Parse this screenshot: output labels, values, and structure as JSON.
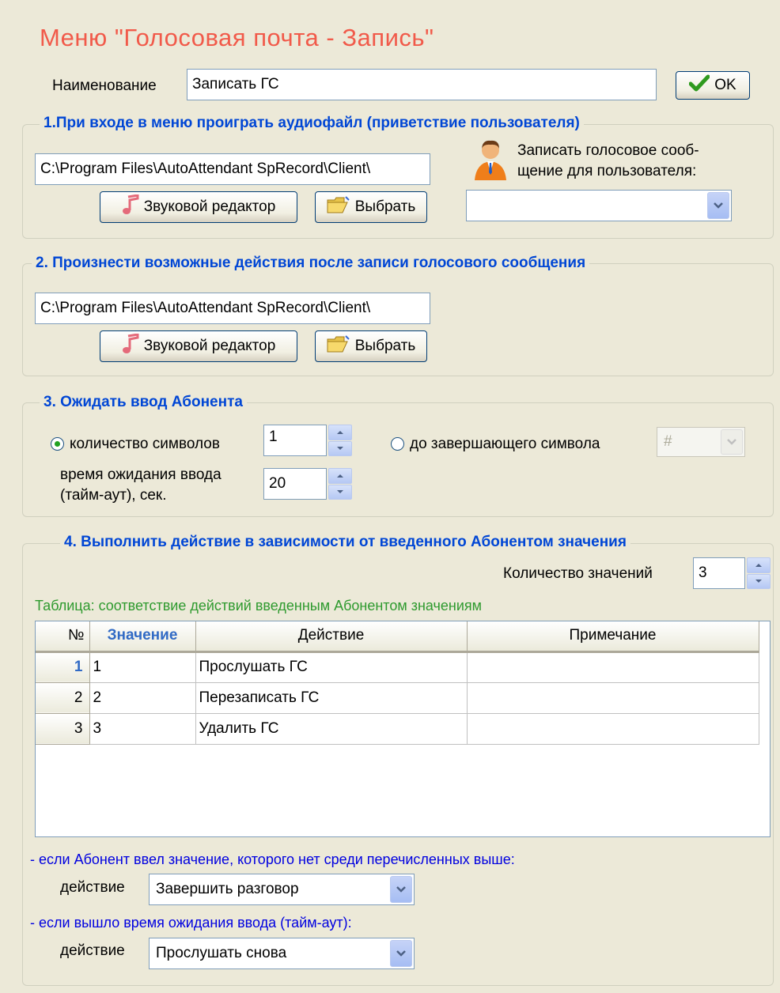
{
  "title": "Меню \"Голосовая почта - Запись\"",
  "name_label": "Наименование",
  "name_value": "Записать ГС",
  "ok_label": "OK",
  "section1": {
    "legend": "1.При входе в меню проиграть аудиофайл (приветствие пользователя)",
    "path": "C:\\Program Files\\AutoAttendant SpRecord\\Client\\",
    "editor_label": "Звуковой редактор",
    "choose_label": "Выбрать",
    "record_label_line1": "Записать голосовое сооб-",
    "record_label_line2": "щение для пользователя:",
    "user_select_value": ""
  },
  "section2": {
    "legend": "2. Произнести возможные действия после записи голосового сообщения",
    "path": "C:\\Program Files\\AutoAttendant SpRecord\\Client\\",
    "editor_label": "Звуковой редактор",
    "choose_label": "Выбрать"
  },
  "section3": {
    "legend": "3. Ожидать ввод Абонента",
    "radio_count_label": "количество символов",
    "count_value": "1",
    "radio_terminator_label": "до завершающего символа",
    "terminator_value": "#",
    "timeout_label_line1": "время ожидания ввода",
    "timeout_label_line2": "(тайм-аут), сек.",
    "timeout_value": "20",
    "radio_count_selected": true
  },
  "section4": {
    "legend": "4. Выполнить действие в зависимости от введенного Абонентом значения",
    "values_count_label": "Количество значений",
    "values_count": "3",
    "table_caption": "Таблица: соответствие действий введенным Абонентом значениям",
    "columns": [
      "№",
      "Значение",
      "Действие",
      "Примечание"
    ],
    "rows": [
      {
        "n": "1",
        "value": "1",
        "action": "Прослушать ГС",
        "note": ""
      },
      {
        "n": "2",
        "value": "2",
        "action": "Перезаписать ГС",
        "note": ""
      },
      {
        "n": "3",
        "value": "3",
        "action": "Удалить ГС",
        "note": ""
      }
    ],
    "no_match_note": "- если Абонент ввел значение, которого нет среди перечисленных выше:",
    "no_match_action_label": "действие",
    "no_match_action": "Завершить разговор",
    "timeout_note": "- если вышло время ожидания ввода (тайм-аут):",
    "timeout_action_label": "действие",
    "timeout_action": "Прослушать снова"
  },
  "colors": {
    "title": "#f15a4a",
    "legend": "#0046d5",
    "note_blue": "#0000e0",
    "note_green": "#2e9a2e"
  }
}
